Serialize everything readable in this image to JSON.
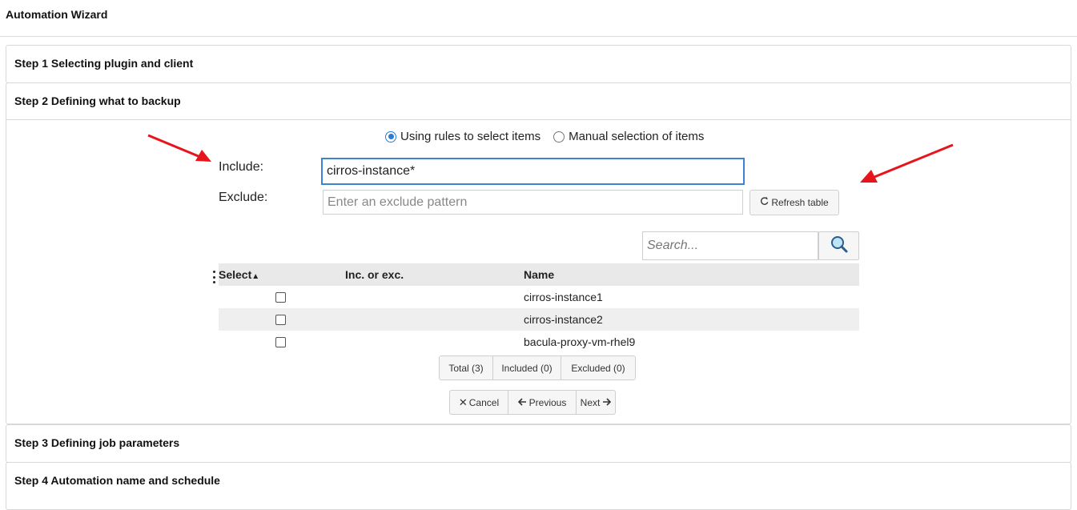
{
  "window": {
    "title": "Automation Wizard"
  },
  "steps": [
    {
      "label": "Step 1 Selecting plugin and client"
    },
    {
      "label": "Step 2 Defining what to backup"
    },
    {
      "label": "Step 3 Defining job parameters"
    },
    {
      "label": "Step 4 Automation name and schedule"
    }
  ],
  "mode": {
    "options": [
      {
        "label": "Using rules to select items",
        "checked": true
      },
      {
        "label": "Manual selection of items",
        "checked": false
      }
    ]
  },
  "form": {
    "include_label": "Include:",
    "include_value": "cirros-instance*",
    "exclude_label": "Exclude:",
    "exclude_placeholder": "Enter an exclude pattern",
    "refresh_label": "Refresh table",
    "refresh_icon": "refresh-icon"
  },
  "table": {
    "search_placeholder": "Search...",
    "search_icon": "magnifier-icon",
    "columns": [
      "Select",
      "Inc. or exc.",
      "Name"
    ],
    "sort_indicator": "▲",
    "rows": [
      {
        "name": "cirros-instance1",
        "checked": false
      },
      {
        "name": "cirros-instance2",
        "checked": false
      },
      {
        "name": "bacula-proxy-vm-rhel9",
        "checked": false
      }
    ]
  },
  "filters": {
    "total": "Total (3)",
    "included": "Included (0)",
    "excluded": "Excluded (0)"
  },
  "nav": {
    "cancel": "Cancel",
    "previous": "Previous",
    "next": "Next"
  },
  "colors": {
    "annotation_arrow": "#e8141c",
    "focus_border": "#3c83d6",
    "radio_accent": "#2b7cd3"
  }
}
